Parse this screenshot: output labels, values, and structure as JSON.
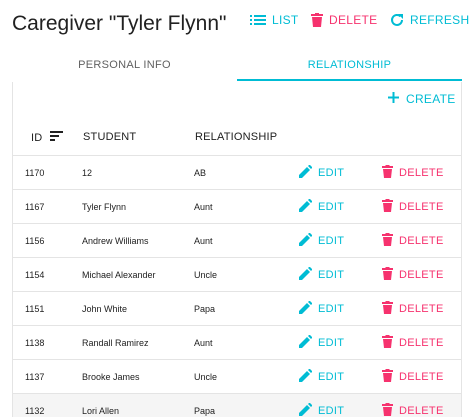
{
  "header": {
    "title": "Caregiver \"Tyler Flynn\"",
    "list_label": "LIST",
    "delete_label": "DELETE",
    "refresh_label": "REFRESH"
  },
  "tabs": [
    {
      "label": "PERSONAL INFO",
      "active": false
    },
    {
      "label": "RELATIONSHIP",
      "active": true
    }
  ],
  "toolbar": {
    "create_label": "CREATE"
  },
  "table": {
    "columns": {
      "id": "ID",
      "student": "STUDENT",
      "relationship": "RELATIONSHIP"
    },
    "edit_label": "EDIT",
    "delete_label": "DELETE",
    "rows": [
      {
        "id": "1170",
        "student": "12",
        "relationship": "AB"
      },
      {
        "id": "1167",
        "student": "Tyler Flynn",
        "relationship": "Aunt"
      },
      {
        "id": "1156",
        "student": "Andrew Williams",
        "relationship": "Aunt"
      },
      {
        "id": "1154",
        "student": "Michael Alexander",
        "relationship": "Uncle"
      },
      {
        "id": "1151",
        "student": "John White",
        "relationship": "Papa"
      },
      {
        "id": "1138",
        "student": "Randall Ramirez",
        "relationship": "Aunt"
      },
      {
        "id": "1137",
        "student": "Brooke James",
        "relationship": "Uncle"
      },
      {
        "id": "1132",
        "student": "Lori Allen",
        "relationship": "Papa"
      }
    ]
  },
  "colors": {
    "accent": "#00bcd4",
    "danger": "#f6326e"
  },
  "icons": {
    "list": "list-icon",
    "delete": "trash-icon",
    "refresh": "refresh-icon",
    "create": "plus-icon",
    "sort": "sort-icon",
    "edit": "pencil-icon"
  }
}
